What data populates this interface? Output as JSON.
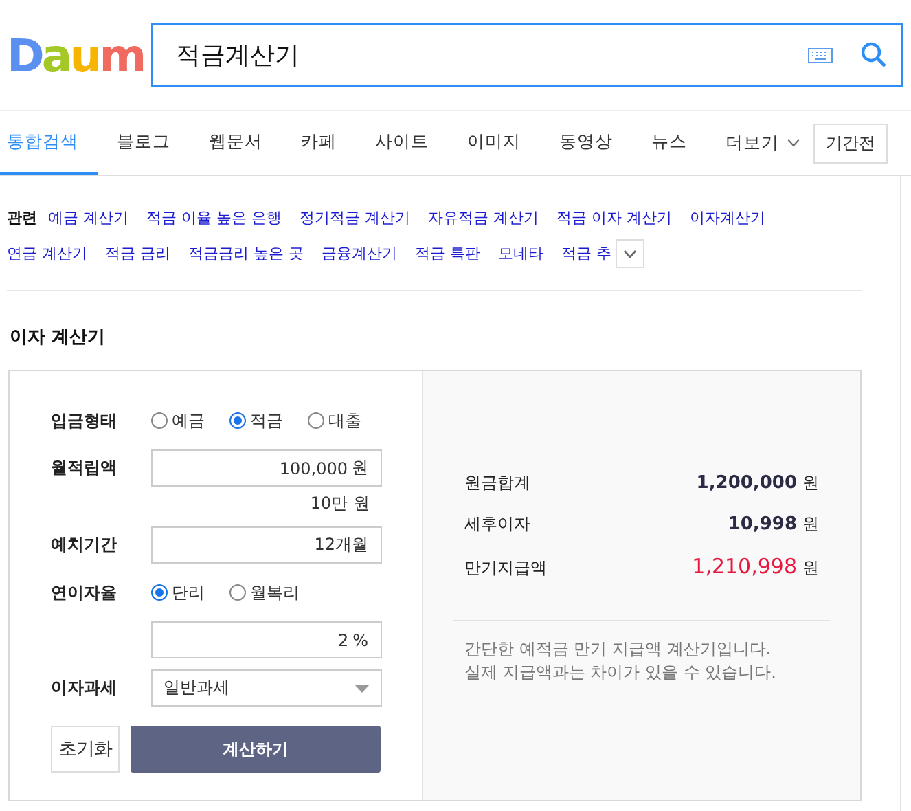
{
  "logo": {
    "letters": [
      {
        "char": "D",
        "color": "#5b8ff0"
      },
      {
        "char": "a",
        "color": "#a4c826"
      },
      {
        "char": "u",
        "color": "#f7b500"
      },
      {
        "char": "m",
        "color": "#f06a5f"
      }
    ]
  },
  "search": {
    "value": "적금계산기"
  },
  "tabs": [
    {
      "label": "통합검색",
      "selected": true
    },
    {
      "label": "블로그",
      "selected": false
    },
    {
      "label": "웹문서",
      "selected": false
    },
    {
      "label": "카페",
      "selected": false
    },
    {
      "label": "사이트",
      "selected": false
    },
    {
      "label": "이미지",
      "selected": false
    },
    {
      "label": "동영상",
      "selected": false
    },
    {
      "label": "뉴스",
      "selected": false
    }
  ],
  "more": "더보기",
  "period": "기간전",
  "related": {
    "label": "관련",
    "links": [
      "예금 계산기",
      "적금 이율 높은 은행",
      "정기적금 계산기",
      "자유적금 계산기",
      "적금 이자 계산기",
      "이자계산기",
      "연금 계산기",
      "적금 금리",
      "적금금리 높은 곳",
      "금융계산기",
      "적금 특판",
      "모네타",
      "적금 추"
    ]
  },
  "calculator": {
    "title": "이자 계산기",
    "rows": [
      {
        "kind": "radio",
        "label": "입금형태",
        "options": [
          {
            "label": "예금",
            "selected": false
          },
          {
            "label": "적금",
            "selected": true
          },
          {
            "label": "대출",
            "selected": false
          }
        ]
      },
      {
        "kind": "input",
        "label": "월적립액",
        "value": "100,000",
        "unit": "원",
        "hint": "10만 원"
      },
      {
        "kind": "input",
        "label": "예치기간",
        "value": "12개월"
      },
      {
        "kind": "radio",
        "label": "연이자율",
        "options": [
          {
            "label": "단리",
            "selected": true
          },
          {
            "label": "월복리",
            "selected": false
          }
        ]
      },
      {
        "kind": "input",
        "value": "2",
        "unit": "%"
      },
      {
        "kind": "select",
        "label": "이자과세",
        "value": "일반과세"
      }
    ],
    "reset": "초기화",
    "submit": "계산하기",
    "results": [
      {
        "label": "원금합계",
        "value": "1,200,000",
        "unit": "원",
        "highlight": false
      },
      {
        "label": "세후이자",
        "value": "10,998",
        "unit": "원",
        "highlight": false
      },
      {
        "label": "만기지급액",
        "value": "1,210,998",
        "unit": "원",
        "highlight": true
      }
    ],
    "note": [
      "간단한 예적금 만기 지급액 계산기입니다.",
      "실제 지급액과는 차이가 있을 수 있습니다."
    ]
  }
}
